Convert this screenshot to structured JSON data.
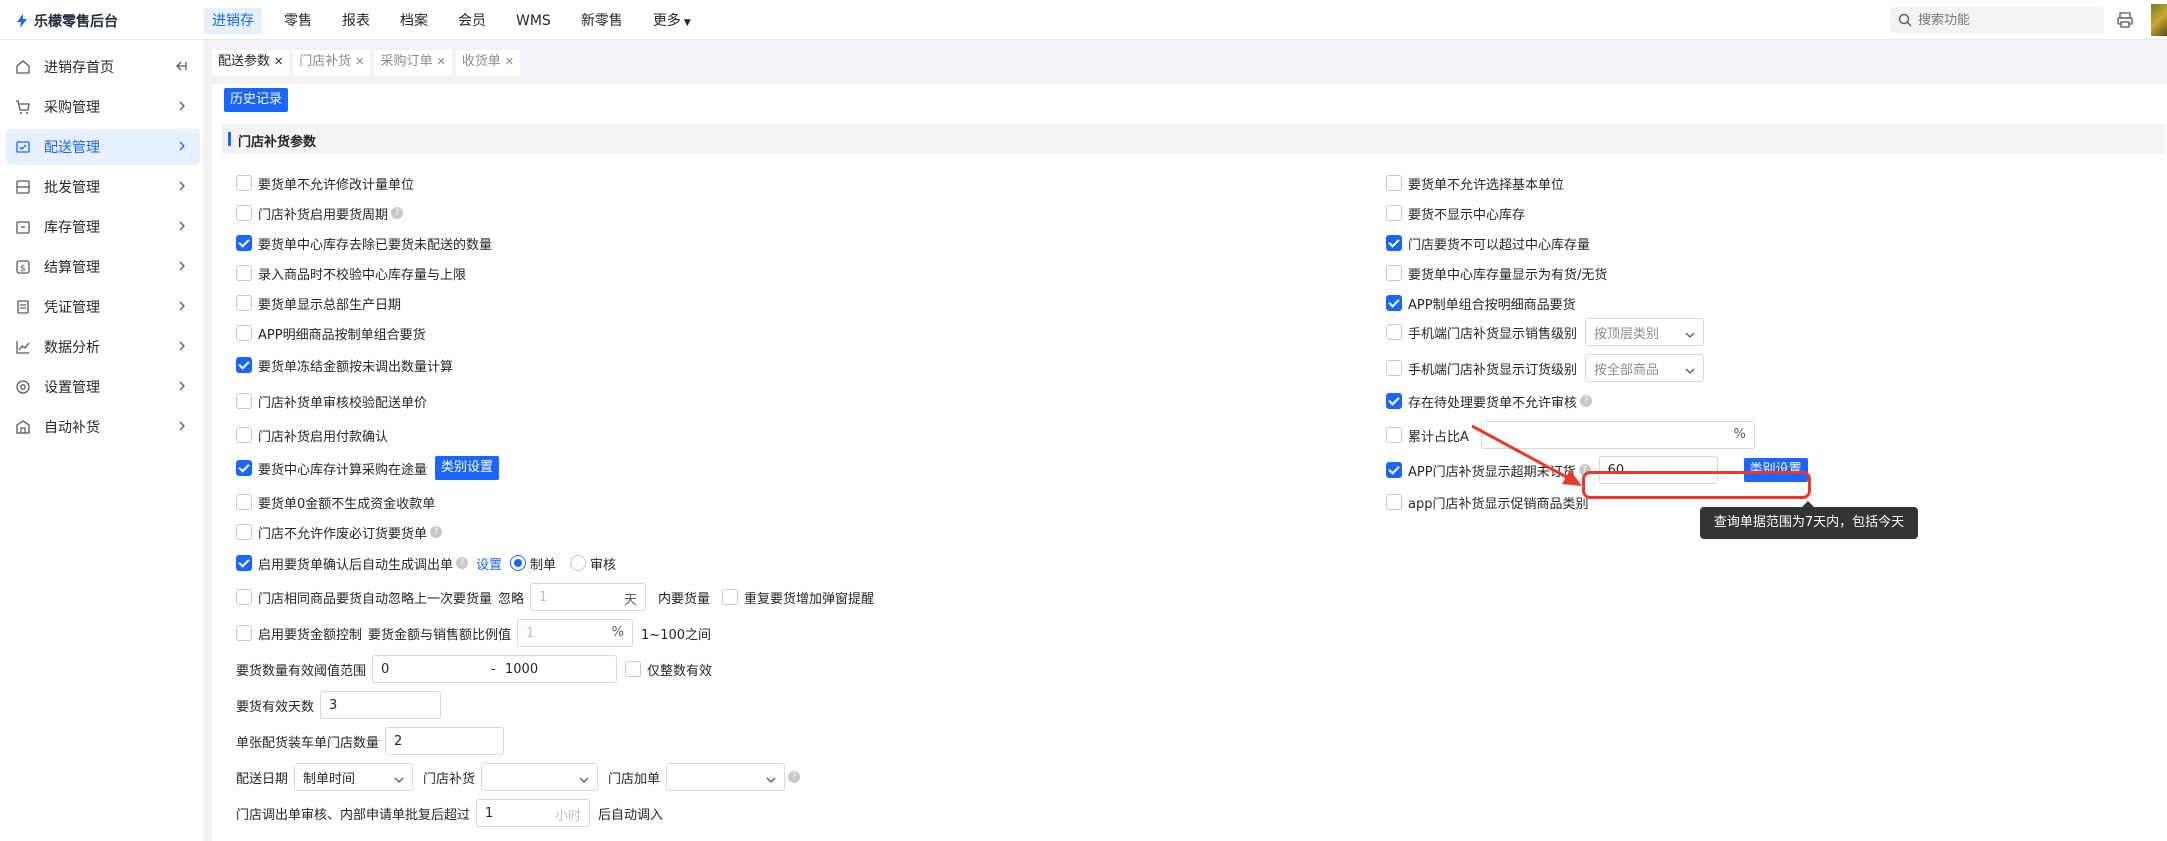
{
  "app": {
    "title": "乐檬零售后台"
  },
  "topnav": [
    "进销存",
    "零售",
    "报表",
    "档案",
    "会员",
    "WMS",
    "新零售",
    "更多"
  ],
  "search": {
    "placeholder": "搜索功能"
  },
  "sidebar": [
    {
      "label": "进销存首页",
      "icon": "home-icon"
    },
    {
      "label": "采购管理",
      "icon": "cart-icon"
    },
    {
      "label": "配送管理",
      "icon": "distribution-icon"
    },
    {
      "label": "批发管理",
      "icon": "wholesale-icon"
    },
    {
      "label": "库存管理",
      "icon": "inventory-icon"
    },
    {
      "label": "结算管理",
      "icon": "settlement-icon"
    },
    {
      "label": "凭证管理",
      "icon": "voucher-icon"
    },
    {
      "label": "数据分析",
      "icon": "chart-icon"
    },
    {
      "label": "设置管理",
      "icon": "settings-icon"
    },
    {
      "label": "自动补货",
      "icon": "auto-replenish-icon"
    }
  ],
  "tabs": [
    "配送参数",
    "门店补货",
    "采购订单",
    "收货单"
  ],
  "history_button": "历史记录",
  "section_title": "门店补货参数",
  "left_options": [
    {
      "label": "要货单不允许修改计量单位",
      "checked": false
    },
    {
      "label": "门店补货启用要货周期",
      "checked": false
    },
    {
      "label": "要货单中心库存去除已要货未配送的数量",
      "checked": true
    },
    {
      "label": "录入商品时不校验中心库存量与上限",
      "checked": false
    },
    {
      "label": "要货单显示总部生产日期",
      "checked": false
    },
    {
      "label": "APP明细商品按制单组合要货",
      "checked": false
    },
    {
      "label": "要货单冻结金额按未调出数量计算",
      "checked": true
    },
    {
      "label": "门店补货单审核校验配送单价",
      "checked": false
    },
    {
      "label": "门店补货启用付款确认",
      "checked": false
    },
    {
      "label": "要货中心库存计算采购在途量",
      "checked": true
    },
    {
      "label": "要货单0金额不生成资金收款单",
      "checked": false
    },
    {
      "label": "门店不允许作废必订货要货单",
      "checked": false
    },
    {
      "label": "启用要货单确认后自动生成调出单",
      "checked": true
    }
  ],
  "category_setting": "类别设置",
  "auto_out": {
    "setting_link": "设置",
    "radio_make": "制单",
    "radio_audit": "审核"
  },
  "ignore_row": {
    "label": "门店相同商品要货自动忽略上一次要货量",
    "ignore": "忽略",
    "value": "1",
    "unit": "天",
    "inner": "内要货量",
    "repeat_label": "重复要货增加弹窗提醒"
  },
  "amount_row": {
    "label": "启用要货金额控制",
    "ratio_label": "要货金额与销售额比例值",
    "value": "1",
    "unit": "%",
    "hint": "1~100之间"
  },
  "range_row": {
    "label": "要货数量有效阈值范围",
    "min": "0",
    "sep": "-",
    "max": "1000",
    "int_label": "仅整数有效"
  },
  "days_row": {
    "label": "要货有效天数",
    "value": "3"
  },
  "stores_row": {
    "label": "单张配货装车单门店数量",
    "value": "2"
  },
  "date_row": {
    "label": "配送日期",
    "value": "制单时间",
    "replenish_label": "门店补货",
    "add_label": "门店加单"
  },
  "auto_in_row": {
    "label": "门店调出单审核、内部申请单批复后超过",
    "value": "1",
    "unit": "小时",
    "after": "后自动调入"
  },
  "right_options": [
    {
      "label": "要货单不允许选择基本单位",
      "checked": false
    },
    {
      "label": "要货不显示中心库存",
      "checked": false
    },
    {
      "label": "门店要货不可以超过中心库存量",
      "checked": true
    },
    {
      "label": "要货单中心库存量显示为有货/无货",
      "checked": false
    },
    {
      "label": "APP制单组合按明细商品要货",
      "checked": true
    },
    {
      "label": "手机端门店补货显示销售级别",
      "checked": false,
      "select": "按顶层类别"
    },
    {
      "label": "手机端门店补货显示订货级别",
      "checked": false,
      "select": "按全部商品"
    },
    {
      "label": "存在待处理要货单不允许审核",
      "checked": true
    },
    {
      "label": "累计占比A",
      "checked": false,
      "unit": "%"
    },
    {
      "label": "APP门店补货显示超期未订货",
      "checked": true,
      "value": "60"
    },
    {
      "label": "app门店补货显示促销商品类别",
      "checked": false
    }
  ],
  "tooltip": "查询单据范围为7天内，包括今天",
  "colors": {
    "primary": "#1a66ff",
    "highlight": "#e8392c"
  }
}
